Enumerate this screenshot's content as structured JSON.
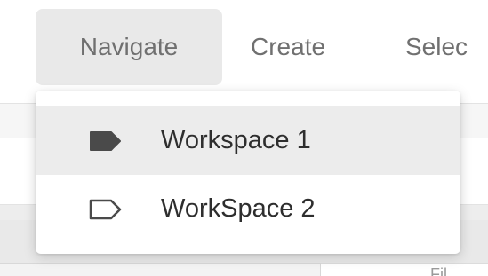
{
  "menubar": {
    "items": [
      {
        "label": "Navigate",
        "active": true
      },
      {
        "label": "Create",
        "active": false
      },
      {
        "label": "Selec",
        "active": false
      }
    ]
  },
  "dropdown": {
    "items": [
      {
        "label": "Workspace 1",
        "icon": "tag-filled-icon",
        "selected": true
      },
      {
        "label": "WorkSpace 2",
        "icon": "tag-outline-icon",
        "selected": false
      }
    ]
  },
  "background": {
    "partial_text": "Fil"
  },
  "colors": {
    "active_menu_bg": "#e9e9e9",
    "menu_text": "#707070",
    "item_text": "#2e2e2e",
    "selected_item_bg": "#ececec",
    "icon_fill": "#4a4a4a"
  }
}
